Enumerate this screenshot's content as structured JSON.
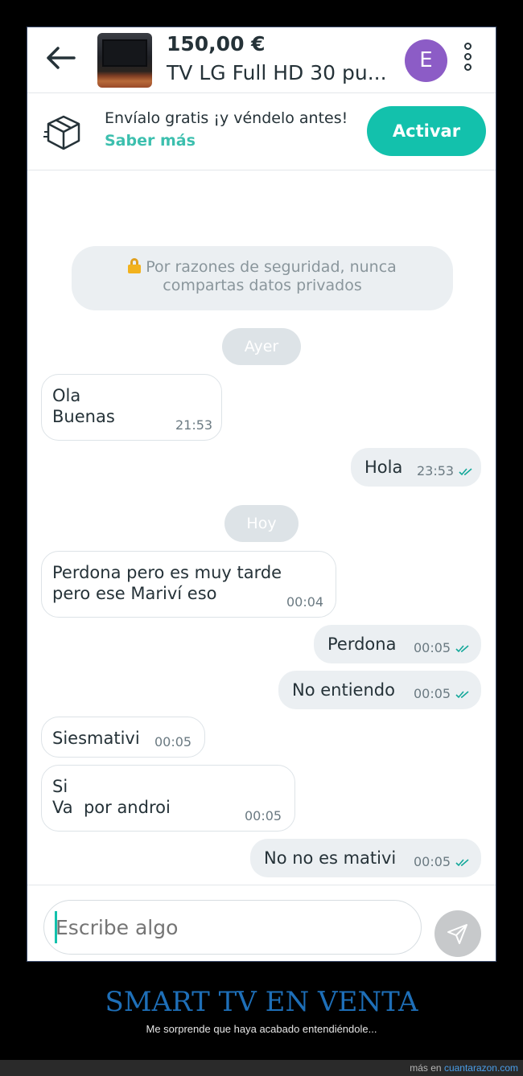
{
  "header": {
    "price": "150,00 €",
    "title": "TV LG Full HD 30 pu...",
    "avatar_initial": "E",
    "avatar_color": "#8c5cc6"
  },
  "banner": {
    "text": "Envíalo gratis ¡y véndelo antes!",
    "link": "Saber más",
    "button": "Activar",
    "accent_color": "#13c1ac"
  },
  "chat": {
    "security_line1": "Por razones de seguridad, nunca",
    "security_line2": "compartas datos privados",
    "days": [
      "Ayer",
      "Hoy"
    ],
    "messages": [
      {
        "dir": "in",
        "text": "Ola\nBuenas",
        "time": "21:53"
      },
      {
        "dir": "out",
        "text": "Hola",
        "time": "23:53",
        "read": true
      },
      {
        "dir": "in",
        "text": "Perdona pero es muy tarde\npero ese Mariví eso",
        "time": "00:04"
      },
      {
        "dir": "out",
        "text": "Perdona",
        "time": "00:05",
        "read": true
      },
      {
        "dir": "out",
        "text": "No entiendo",
        "time": "00:05",
        "read": true
      },
      {
        "dir": "in",
        "text": "Siesmativi",
        "time": "00:05"
      },
      {
        "dir": "in",
        "text": "Si\nVa  por androi",
        "time": "00:05"
      },
      {
        "dir": "out",
        "text": "No no es mativi",
        "time": "00:05",
        "read": true
      }
    ]
  },
  "input": {
    "placeholder": "Escribe algo"
  },
  "caption": {
    "title": "SMART TV EN VENTA",
    "subtitle": "Me sorprende que haya acabado entendiéndole...",
    "footer_prefix": "más en",
    "footer_link": "cuantarazon.com"
  }
}
